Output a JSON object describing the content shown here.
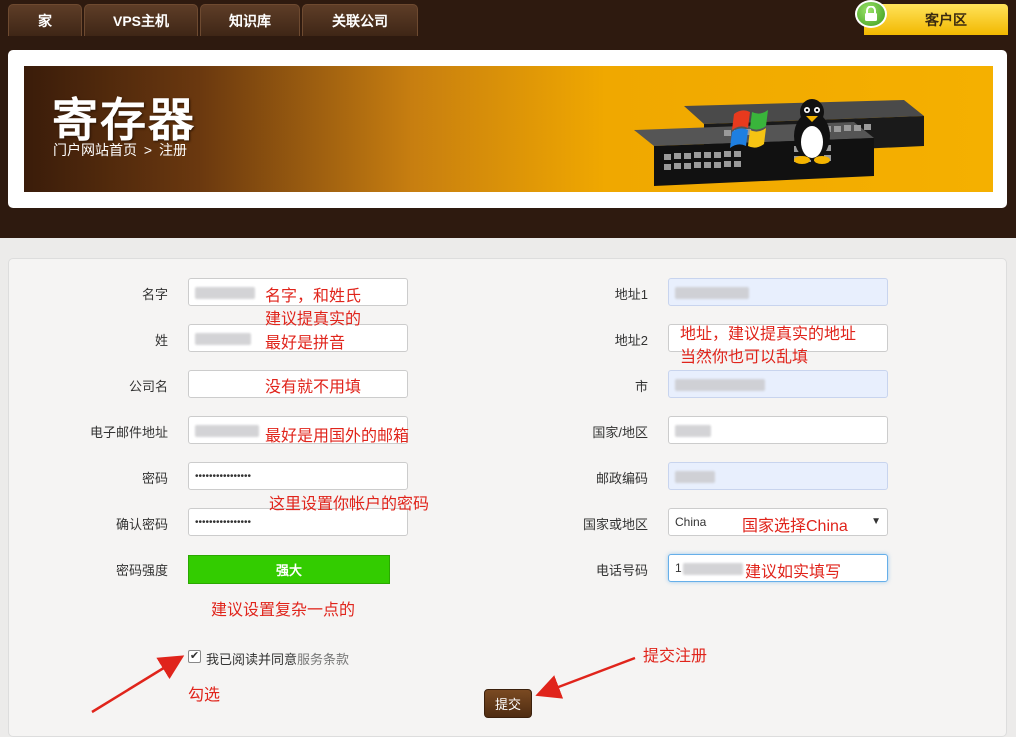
{
  "nav": {
    "tabs": [
      "家",
      "VPS主机",
      "知识库",
      "关联公司"
    ],
    "client_area": "客户区"
  },
  "banner": {
    "title": "寄存器",
    "breadcrumb_home": "门户网站首页",
    "breadcrumb_sep": ">",
    "breadcrumb_current": "注册"
  },
  "form": {
    "first_name_label": "名字",
    "last_name_label": "姓",
    "company_label": "公司名",
    "email_label": "电子邮件地址",
    "password_label": "密码",
    "password_value": "••••••••••••••••",
    "confirm_password_label": "确认密码",
    "confirm_password_value": "••••••••••••••••",
    "strength_label": "密码强度",
    "strength_value": "强大",
    "address1_label": "地址1",
    "address2_label": "地址2",
    "city_label": "市",
    "state_label": "国家/地区",
    "postcode_label": "邮政编码",
    "country_label": "国家或地区",
    "country_value": "China",
    "phone_label": "电话号码",
    "phone_value": "1",
    "tos_prefix": "我已阅读并同意",
    "tos_link": "服务条款",
    "submit_label": "提交"
  },
  "annotations": {
    "name1": "名字，和姓氏",
    "name2": "建议提真实的",
    "name3": "最好是拼音",
    "company": "没有就不用填",
    "email": "最好是用国外的邮箱",
    "password": "这里设置你帐户的密码",
    "strength": "建议设置复杂一点的",
    "address1": "地址，建议提真实的地址",
    "address2": "当然你也可以乱填",
    "country": "国家选择China",
    "phone": "建议如实填写",
    "check": "勾选",
    "submit": "提交注册"
  },
  "colors": {
    "annotation": "#e0241b",
    "strength_bar": "#33cc00",
    "nav_bg": "#2e1a0f",
    "client_tab": "#f2b800"
  },
  "icons": {
    "lock": "lock-icon",
    "checkbox": "checkmark-icon",
    "select": "chevron-down-icon"
  }
}
